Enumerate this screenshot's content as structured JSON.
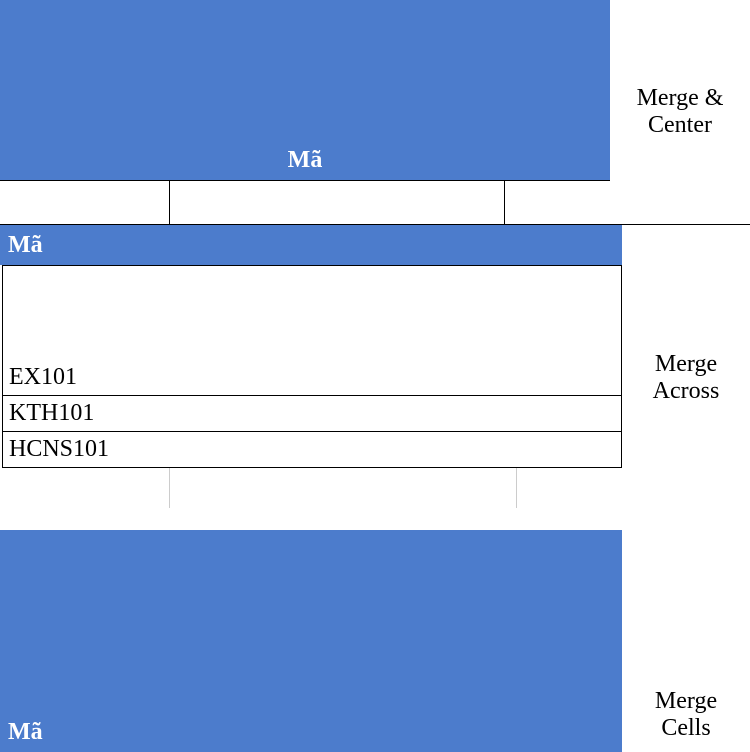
{
  "section1": {
    "header": "Mã",
    "label": "Merge & Center"
  },
  "section2": {
    "header": "Mã",
    "rows": {
      "r1": "EX101",
      "r2": "KTH101",
      "r3": "HCNS101"
    },
    "label": "Merge Across"
  },
  "section3": {
    "header": "Mã",
    "label": "Merge Cells"
  }
}
